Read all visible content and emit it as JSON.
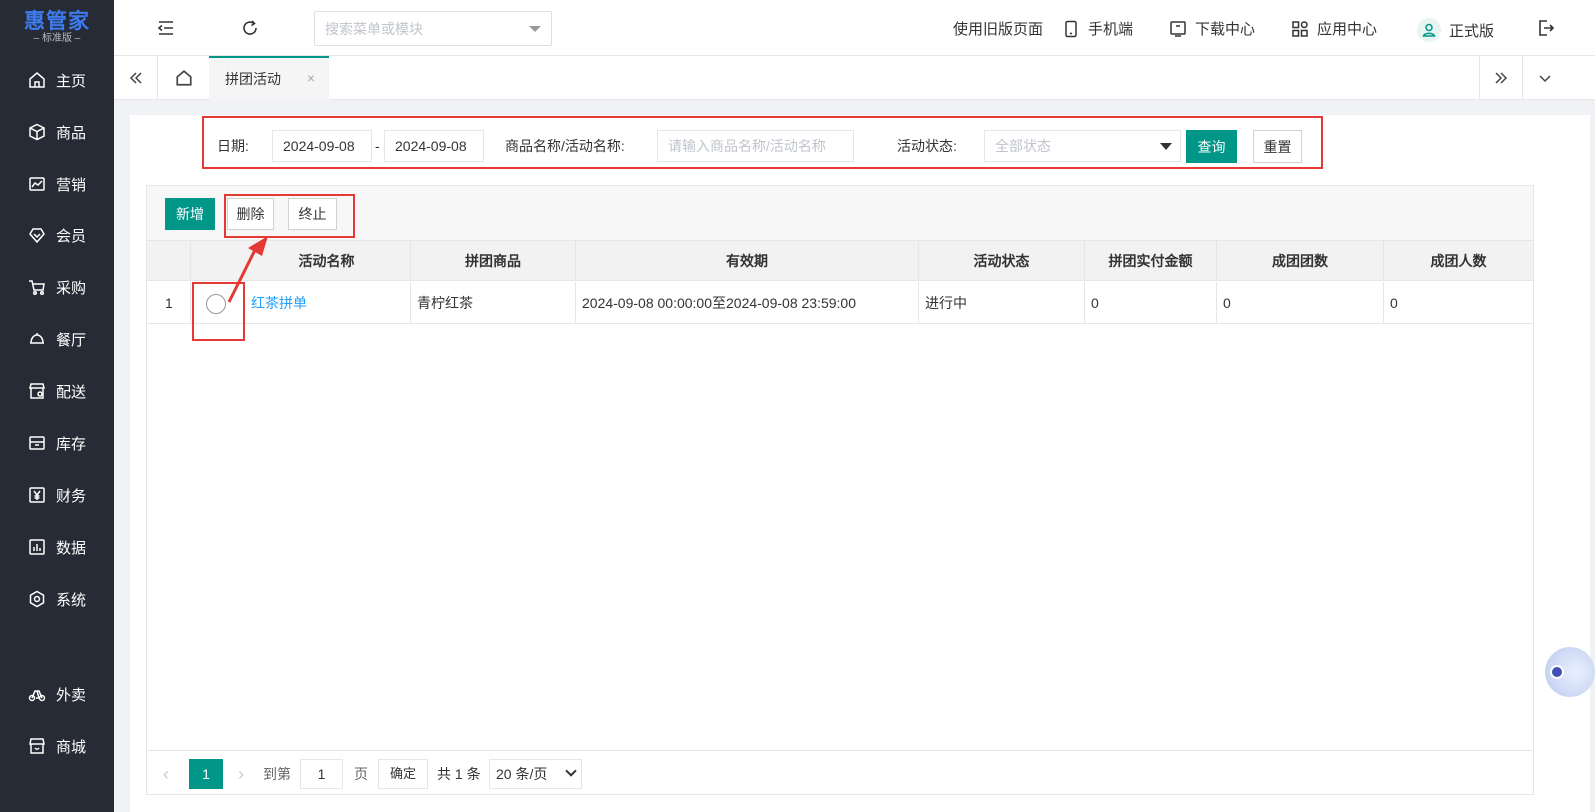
{
  "app": {
    "brand": "惠管家",
    "edition": "– 标准版 –"
  },
  "sidebar": {
    "items": [
      {
        "label": "主页",
        "icon": "home-icon"
      },
      {
        "label": "商品",
        "icon": "box-icon"
      },
      {
        "label": "营销",
        "icon": "chart-icon"
      },
      {
        "label": "会员",
        "icon": "diamond-icon"
      },
      {
        "label": "采购",
        "icon": "cart-icon"
      },
      {
        "label": "餐厅",
        "icon": "cloche-icon"
      },
      {
        "label": "配送",
        "icon": "shop-icon"
      },
      {
        "label": "库存",
        "icon": "inbox-icon"
      },
      {
        "label": "财务",
        "icon": "yen-icon"
      },
      {
        "label": "数据",
        "icon": "bar-chart-icon"
      },
      {
        "label": "系统",
        "icon": "settings-icon"
      },
      {
        "label": "外卖",
        "icon": "bike-icon"
      },
      {
        "label": "商城",
        "icon": "store-icon"
      }
    ]
  },
  "topbar": {
    "search_placeholder": "搜索菜单或模块",
    "old_version": "使用旧版页面",
    "mobile": "手机端",
    "download": "下载中心",
    "apps": "应用中心",
    "account": "正式版"
  },
  "tabs": {
    "active_label": "拼团活动",
    "close": "×"
  },
  "filter": {
    "date_label": "日期:",
    "date_start": "2024-09-08",
    "date_sep": "-",
    "date_end": "2024-09-08",
    "name_label": "商品名称/活动名称:",
    "name_placeholder": "请输入商品名称/活动名称",
    "status_label": "活动状态:",
    "status_value": "全部状态",
    "query": "查询",
    "reset": "重置"
  },
  "toolbar": {
    "add": "新增",
    "delete": "删除",
    "stop": "终止"
  },
  "table": {
    "headers": [
      "活动名称",
      "拼团商品",
      "有效期",
      "活动状态",
      "拼团实付金额",
      "成团团数",
      "成团人数"
    ],
    "rows": [
      {
        "index": "1",
        "name": "红茶拼单",
        "product": "青柠红茶",
        "period": "2024-09-08 00:00:00至2024-09-08 23:59:00",
        "status": "进行中",
        "amount": "0",
        "groups": "0",
        "people": "0"
      }
    ]
  },
  "pager": {
    "current": "1",
    "goto_label": "到第",
    "goto_value": "1",
    "page_unit": "页",
    "confirm": "确定",
    "total": "共 1 条",
    "page_size": "20 条/页"
  },
  "colors": {
    "primary": "#009688",
    "sidebar_bg": "#262b35",
    "brand": "#3d7cf0",
    "link": "#1e9fff",
    "highlight_box": "#e53935"
  }
}
